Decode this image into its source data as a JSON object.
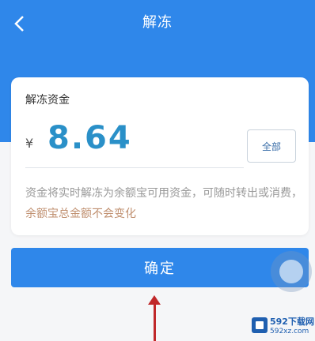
{
  "header": {
    "back_icon": "chevron-left-icon",
    "title": "解冻",
    "color": "#2f87ea"
  },
  "card": {
    "label": "解冻资金",
    "currency": "¥",
    "amount": "8.64",
    "all_button": "全部",
    "desc_plain": "资金将实时解冻为余额宝可用资金，可随时转出或消费，",
    "desc_highlight": "余额宝总金额不会变化"
  },
  "confirm_button": "确定",
  "watermark": {
    "text": "592下载网",
    "sub": "592xz.com"
  }
}
